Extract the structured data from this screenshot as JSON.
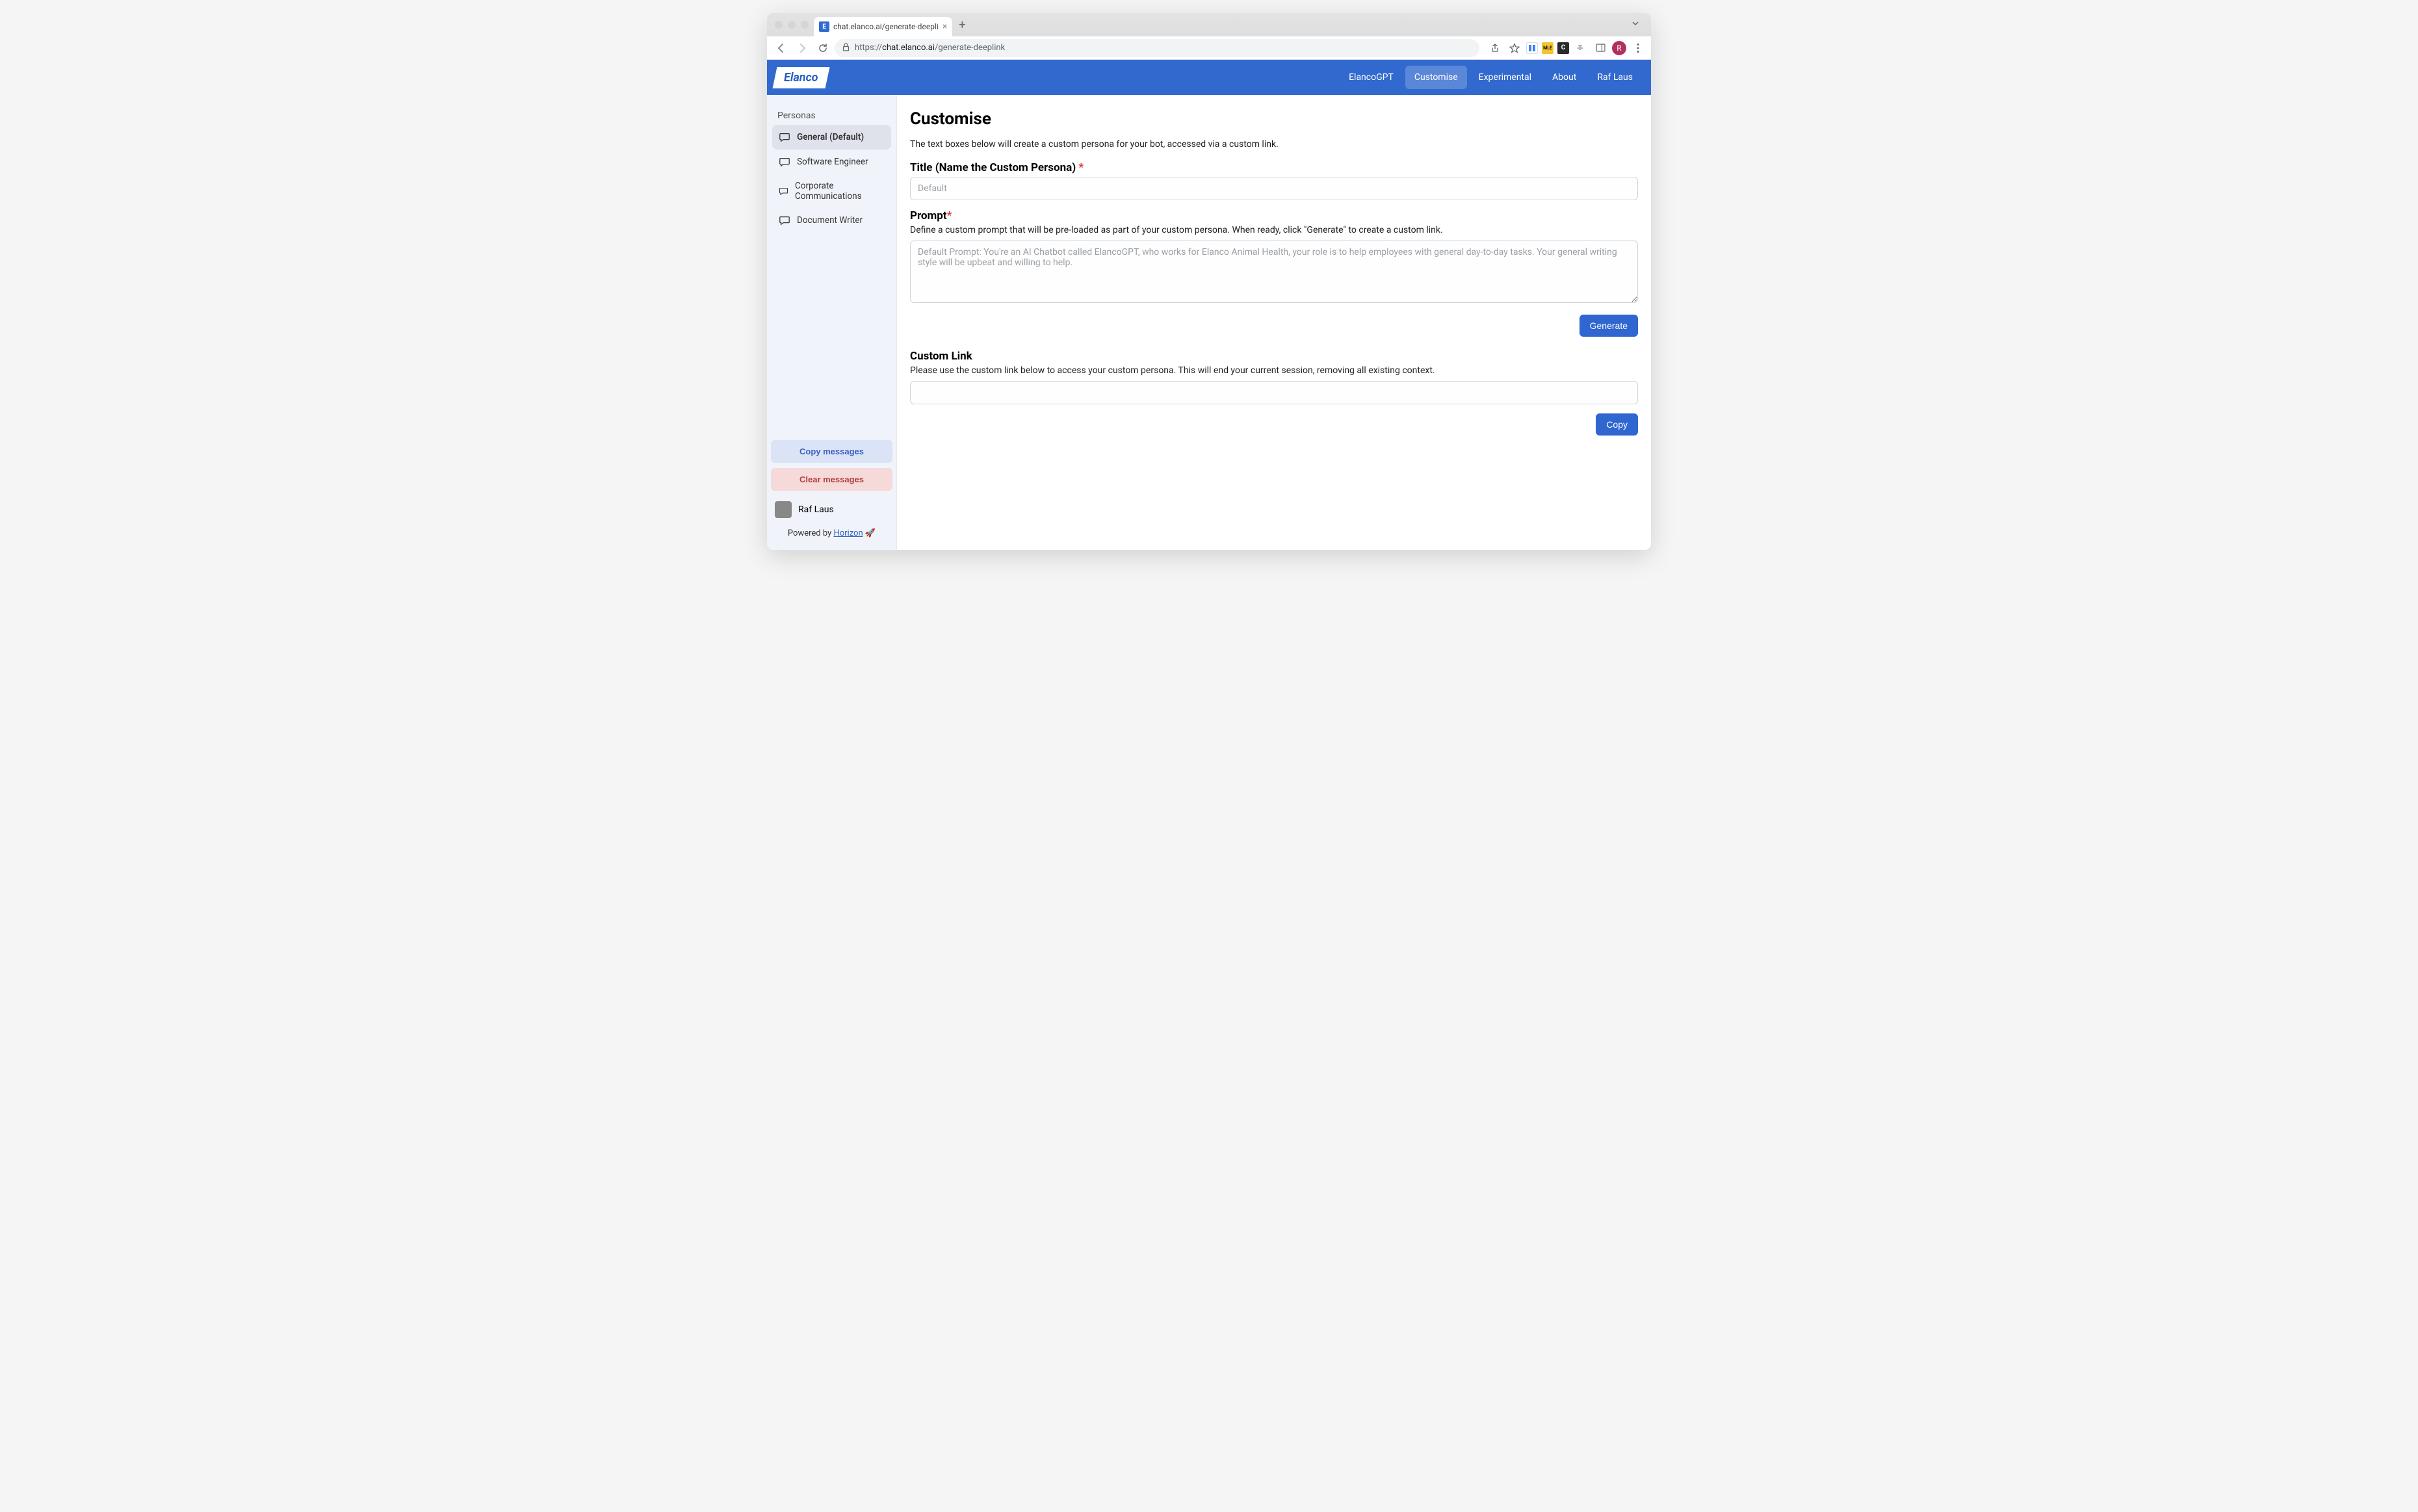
{
  "browser": {
    "tab": {
      "favicon_letter": "E",
      "title": "chat.elanco.ai/generate-deepli"
    },
    "url_prefix": "https://",
    "url_domain": "chat.elanco.ai",
    "url_path": "/generate-deeplink",
    "avatar_letter": "R"
  },
  "header": {
    "logo_text": "Elanco",
    "nav": {
      "elancogpt": "ElancoGPT",
      "customise": "Customise",
      "experimental": "Experimental",
      "about": "About",
      "user": "Raf Laus"
    },
    "active_nav": "customise"
  },
  "sidebar": {
    "heading": "Personas",
    "items": [
      {
        "label": "General (Default)",
        "active": true
      },
      {
        "label": "Software Engineer",
        "active": false
      },
      {
        "label": "Corporate Communications",
        "active": false
      },
      {
        "label": "Document Writer",
        "active": false
      }
    ],
    "copy_button": "Copy messages",
    "clear_button": "Clear messages",
    "user_name": "Raf Laus",
    "powered_by_prefix": "Powered by ",
    "powered_by_link": "Horizon",
    "powered_by_emoji": "🚀"
  },
  "main": {
    "title": "Customise",
    "description": "The text boxes below will create a custom persona for your bot, accessed via a custom link.",
    "title_field": {
      "label": "Title (Name the Custom Persona)",
      "placeholder": "Default"
    },
    "prompt_field": {
      "label": "Prompt",
      "help": "Define a custom prompt that will be pre-loaded as part of your custom persona. When ready, click \"Generate\" to create a custom link.",
      "placeholder": "Default Prompt: You're an AI Chatbot called ElancoGPT, who works for Elanco Animal Health, your role is to help employees with general day-to-day tasks. Your general writing style will be upbeat and willing to help."
    },
    "generate_button": "Generate",
    "custom_link": {
      "label": "Custom Link",
      "help": "Please use the custom link below to access your custom persona. This will end your current session, removing all existing context."
    },
    "copy_button": "Copy"
  }
}
